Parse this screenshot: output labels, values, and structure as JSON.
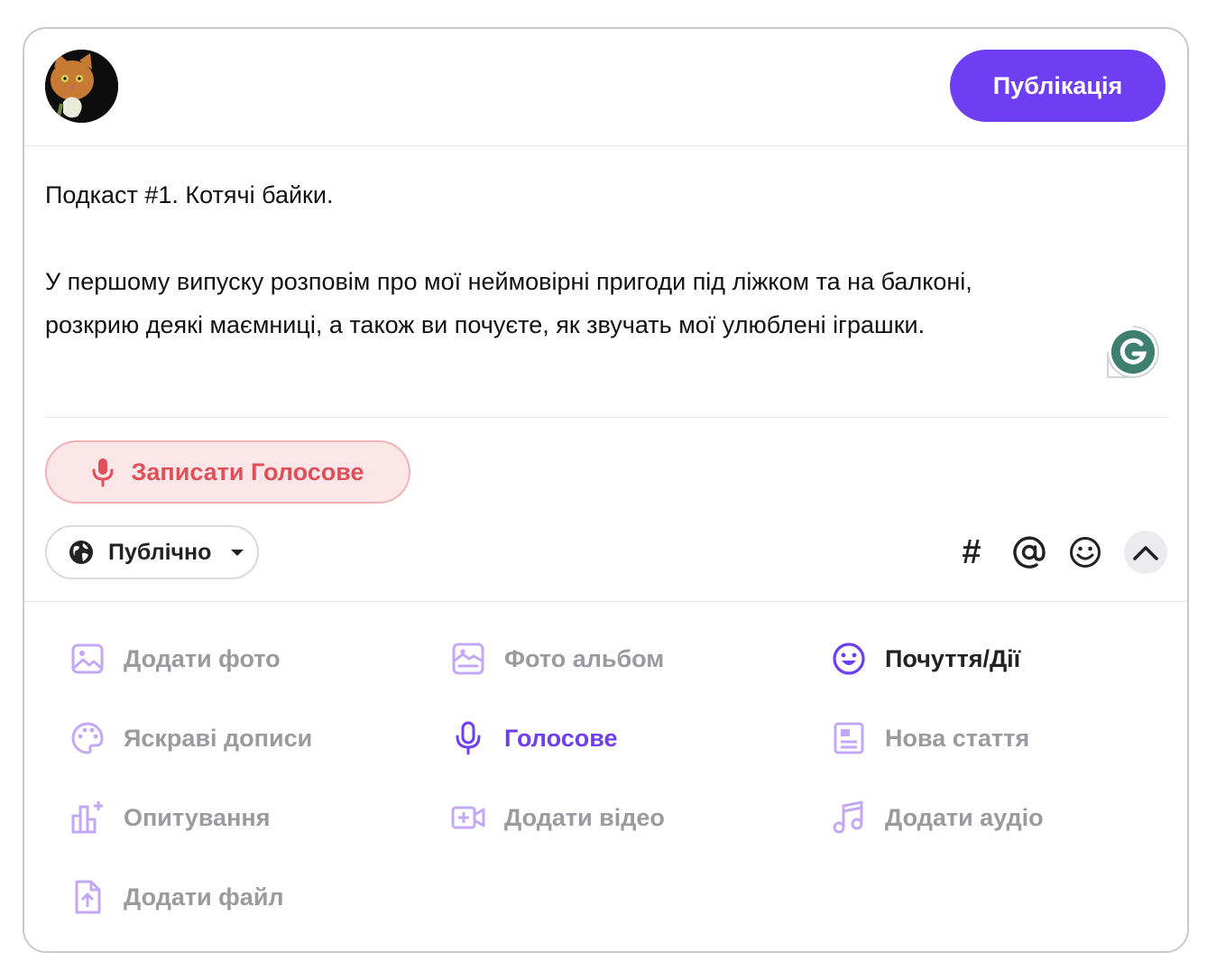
{
  "header": {
    "publish_label": "Публікація"
  },
  "post": {
    "title": "Подкаст #1. Котячі байки.",
    "line1": "У першому випуску розповім про мої неймовірні пригоди під ліжком та на балконі,",
    "line2": "розкрию деякі маємниці, а також ви почуєте, як  звучать мої улюблені іграшки."
  },
  "record": {
    "label": "Записати Голосове"
  },
  "audience": {
    "label": "Публічно"
  },
  "tools": {
    "hash": "#"
  },
  "options": {
    "add_photo": "Додати фото",
    "photo_album": "Фото альбом",
    "feelings": "Почуття/Дії",
    "bright_posts": "Яскраві дописи",
    "voice": "Голосове",
    "new_article": "Нова стаття",
    "poll": "Опитування",
    "add_video": "Додати відео",
    "add_audio": "Додати аудіо",
    "add_file": "Додати файл"
  },
  "colors": {
    "accent": "#6e3ff2",
    "record_text": "#e0505a",
    "record_bg": "#fce7e8",
    "muted_icon": "#c3a8f5",
    "muted_text": "#9b9b9f"
  }
}
